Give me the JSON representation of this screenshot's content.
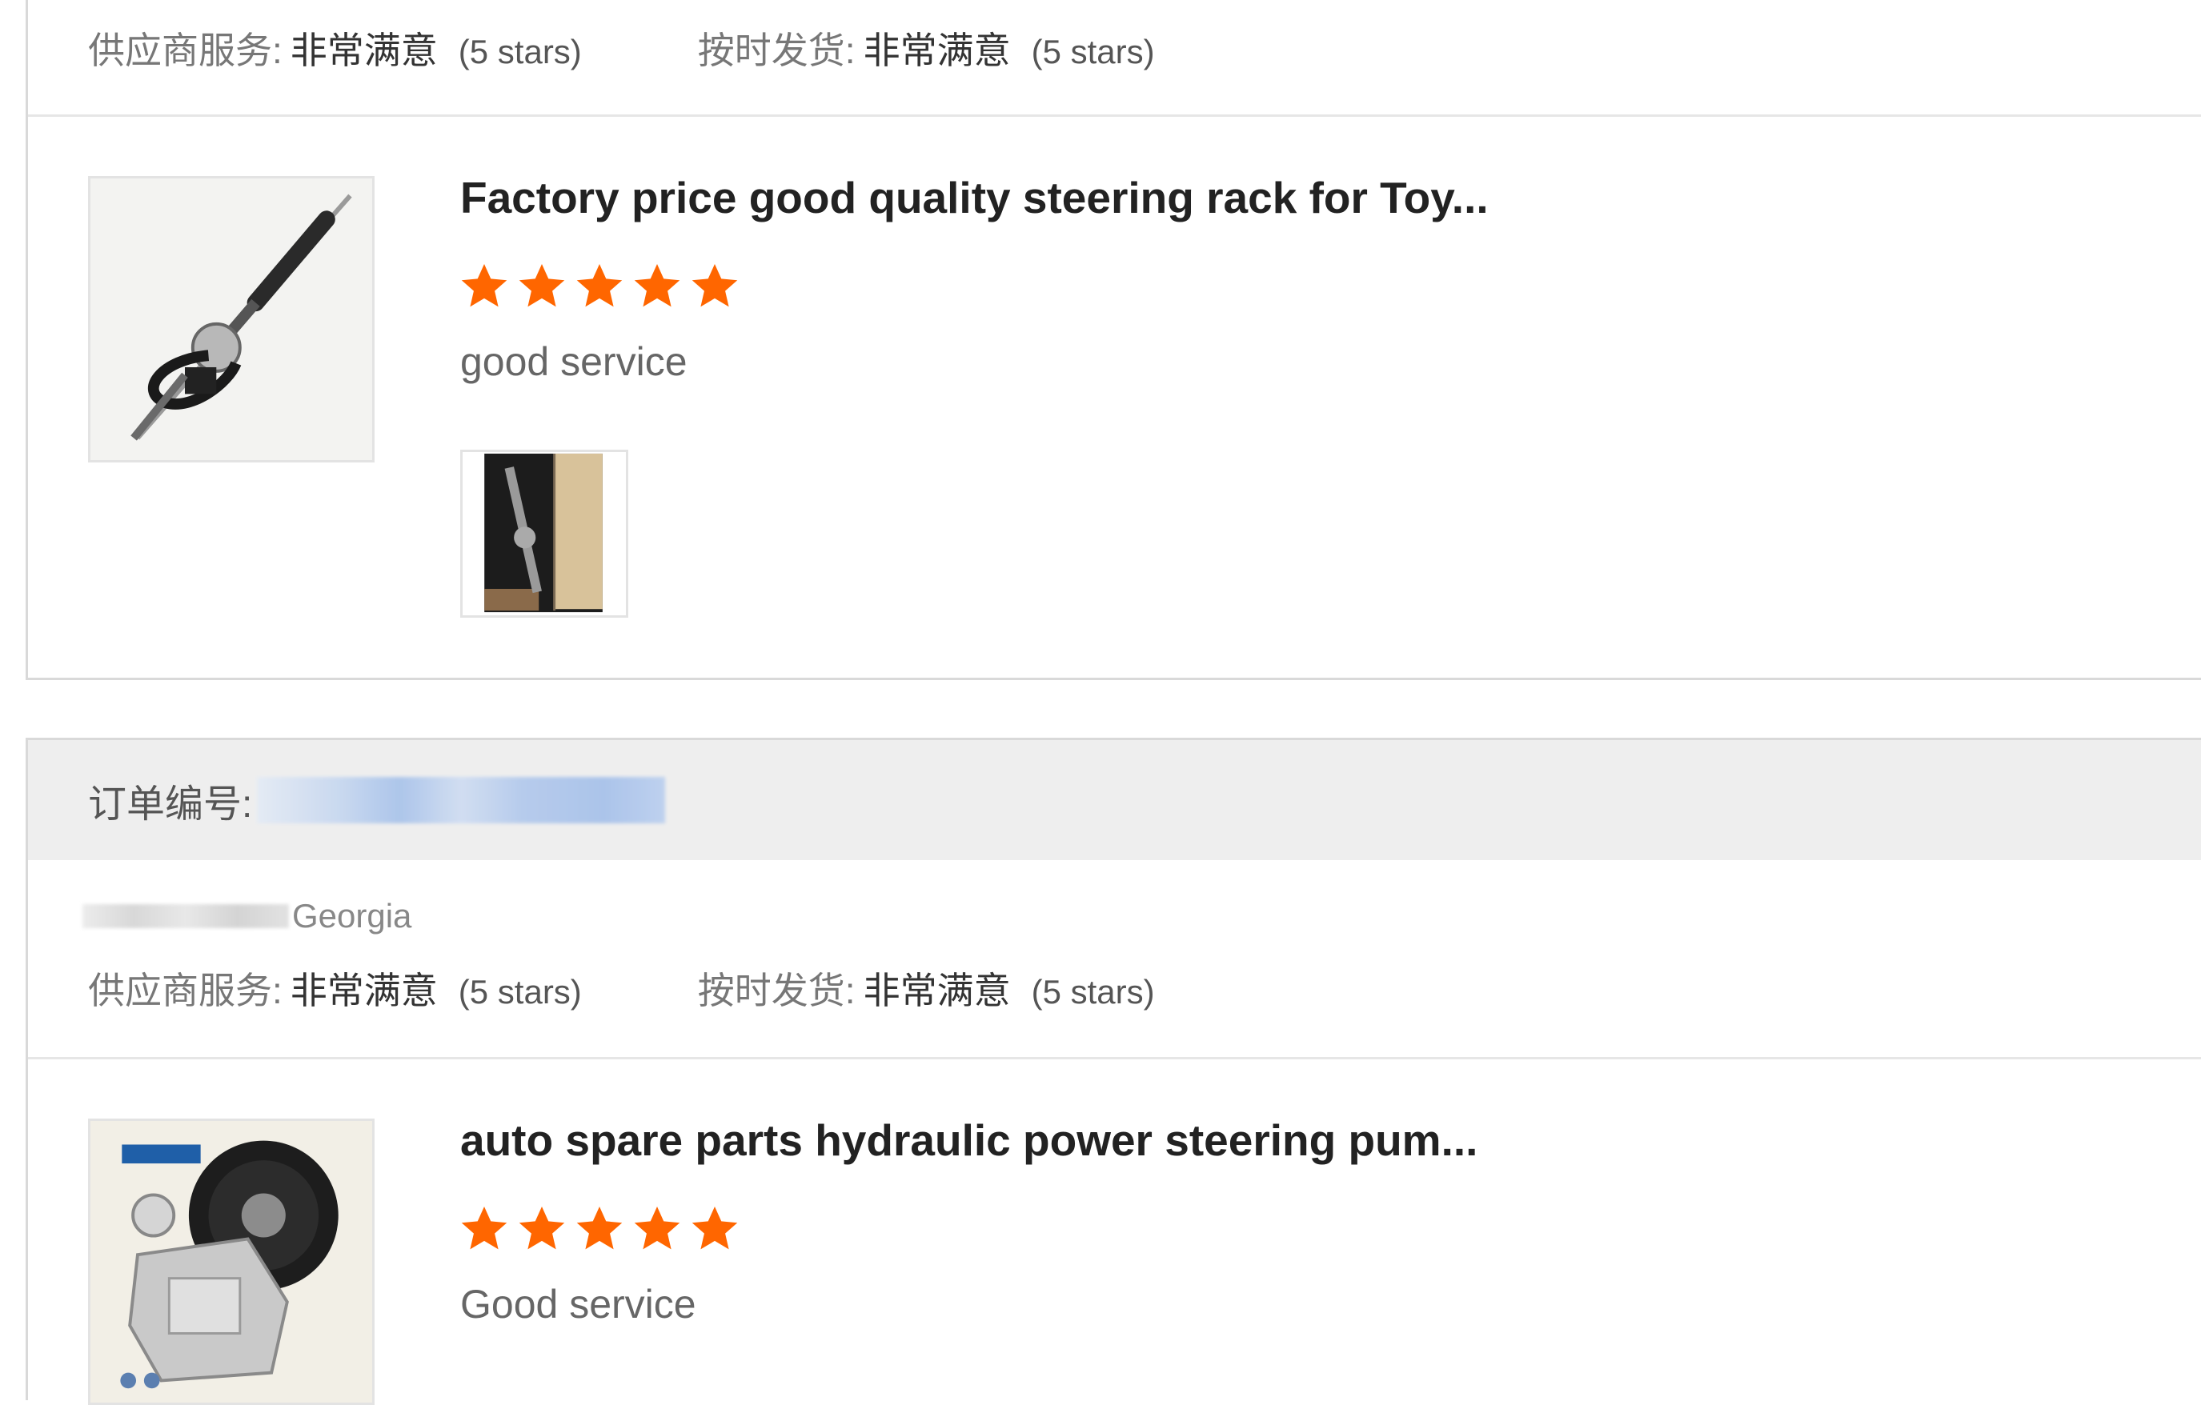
{
  "colors": {
    "star": "#ff6600",
    "header_bg": "#eeeeee",
    "border": "#d9d9d9"
  },
  "card1": {
    "supplier_label": "供应商服务:",
    "supplier_value": "非常满意",
    "supplier_stars": "(5 stars)",
    "shipping_label": "按时发货:",
    "shipping_value": "非常满意",
    "shipping_stars": "(5 stars)",
    "product": {
      "image_icon": "steering-rack-image",
      "title": "Factory price good quality steering rack for Toy...",
      "rating": 5,
      "review": "good service",
      "photo_icon": "review-photo-package"
    }
  },
  "card2": {
    "order_label": "订单编号:",
    "location": "Georgia",
    "supplier_label": "供应商服务:",
    "supplier_value": "非常满意",
    "supplier_stars": "(5 stars)",
    "shipping_label": "按时发货:",
    "shipping_value": "非常满意",
    "shipping_stars": "(5 stars)",
    "product": {
      "image_icon": "power-steering-pump-image",
      "title": "auto spare parts hydraulic power steering pum...",
      "rating": 5,
      "review": "Good service"
    }
  }
}
